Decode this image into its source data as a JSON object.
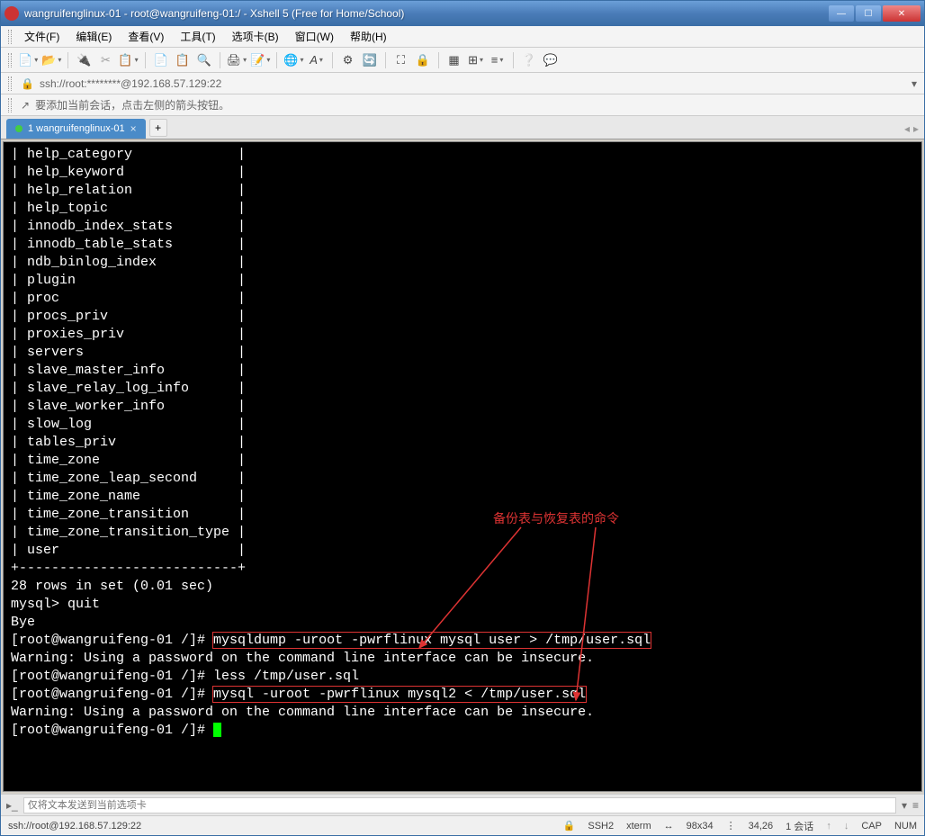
{
  "titlebar": {
    "text": "wangruifenglinux-01 - root@wangruifeng-01:/ - Xshell 5 (Free for Home/School)"
  },
  "menu": {
    "file": "文件(F)",
    "edit": "编辑(E)",
    "view": "查看(V)",
    "tools": "工具(T)",
    "tabs": "选项卡(B)",
    "window": "窗口(W)",
    "help": "帮助(H)"
  },
  "addressbar": {
    "text": "ssh://root:********@192.168.57.129:22"
  },
  "hintbar": {
    "text": "要添加当前会话，点击左侧的箭头按钮。"
  },
  "tab": {
    "label": "1 wangruifenglinux-01"
  },
  "terminal": {
    "tables": [
      "help_category",
      "help_keyword",
      "help_relation",
      "help_topic",
      "innodb_index_stats",
      "innodb_table_stats",
      "ndb_binlog_index",
      "plugin",
      "proc",
      "procs_priv",
      "proxies_priv",
      "servers",
      "slave_master_info",
      "slave_relay_log_info",
      "slave_worker_info",
      "slow_log",
      "tables_priv",
      "time_zone",
      "time_zone_leap_second",
      "time_zone_name",
      "time_zone_transition",
      "time_zone_transition_type",
      "user"
    ],
    "footer_sep": "+---------------------------+",
    "rows_line": "28 rows in set (0.01 sec)",
    "mysql_prompt": "mysql> quit",
    "bye": "Bye",
    "prompt": "[root@wangruifeng-01 /]# ",
    "cmd_dump": "mysqldump -uroot -pwrflinux mysql user > /tmp/user.sql",
    "warn": "Warning: Using a password on the command line interface can be insecure.",
    "cmd_less": "less /tmp/user.sql",
    "cmd_restore": "mysql -uroot -pwrflinux mysql2 < /tmp/user.sql",
    "annotation": "备份表与恢复表的命令"
  },
  "sendbar": {
    "placeholder": "仅将文本发送到当前选项卡"
  },
  "statusbar": {
    "conn": "ssh://root@192.168.57.129:22",
    "ssh": "SSH2",
    "term": "xterm",
    "size": "98x34",
    "pos": "34,26",
    "sessions": "1 会话",
    "caps": "CAP",
    "num": "NUM"
  }
}
